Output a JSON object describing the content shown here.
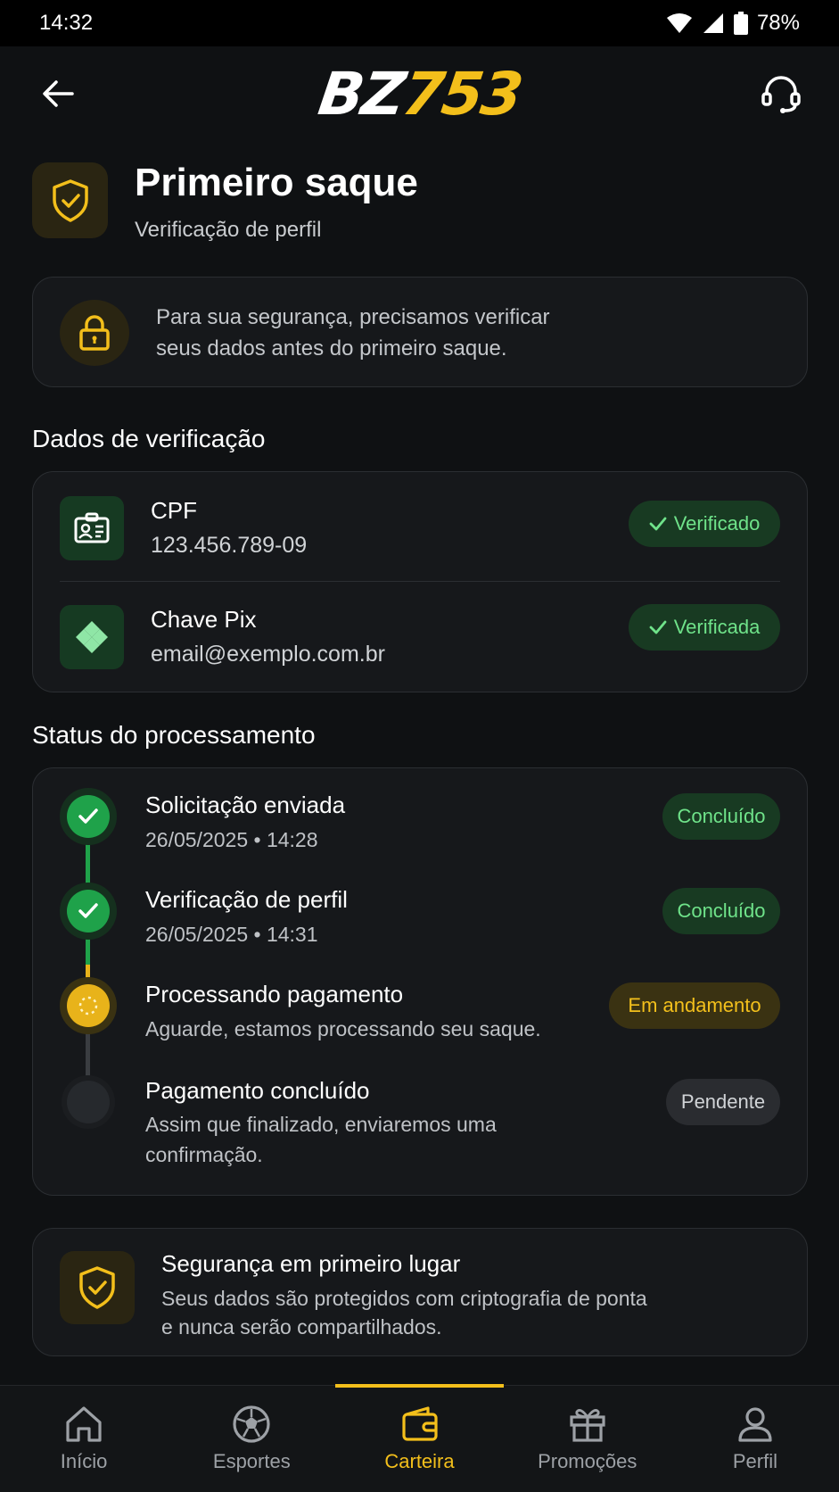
{
  "status_bar": {
    "time": "14:32",
    "battery": "78%"
  },
  "header": {
    "logo_letters": "BZ",
    "logo_number": "753",
    "back_icon": "arrow-left-icon",
    "support_icon": "headset-icon"
  },
  "page": {
    "title": "Primeiro saque",
    "subtitle": "Verificação de perfil"
  },
  "notice": {
    "line1": "Para sua segurança, precisamos verificar",
    "line2": "seus dados antes do primeiro saque."
  },
  "verification": {
    "section_title": "Dados de verificação",
    "items": [
      {
        "label": "CPF",
        "value": "123.456.789-09",
        "badge": "Verificado",
        "icon": "id-card-icon"
      },
      {
        "label": "Chave Pix",
        "value": "email@exemplo.com.br",
        "badge": "Verificada",
        "icon": "pix-icon"
      }
    ]
  },
  "processing": {
    "section_title": "Status do processamento",
    "steps": [
      {
        "title": "Solicitação enviada",
        "desc": "26/05/2025 • 14:28",
        "badge": "Concluído"
      },
      {
        "title": "Verificação de perfil",
        "desc": "26/05/2025 • 14:31",
        "badge": "Concluído"
      },
      {
        "title": "Processando pagamento",
        "desc": "Aguarde, estamos processando seu saque.",
        "badge": "Em andamento"
      },
      {
        "title": "Pagamento concluído",
        "desc1": "Assim que finalizado, enviaremos uma",
        "desc2": "confirmação.",
        "badge": "Pendente"
      }
    ]
  },
  "security": {
    "title": "Segurança em primeiro lugar",
    "line1": "Seus dados são protegidos com criptografia de ponta",
    "line2": "e nunca serão compartilhados."
  },
  "nav": {
    "items": [
      {
        "label": "Início",
        "icon": "home-icon"
      },
      {
        "label": "Esportes",
        "icon": "soccer-ball-icon"
      },
      {
        "label": "Carteira",
        "icon": "wallet-icon",
        "active": true
      },
      {
        "label": "Promoções",
        "icon": "gift-icon"
      },
      {
        "label": "Perfil",
        "icon": "user-icon"
      }
    ]
  },
  "colors": {
    "accent": "#f3bf1b",
    "success": "#6fe38a",
    "background": "#0f1113",
    "card": "#16181b"
  }
}
